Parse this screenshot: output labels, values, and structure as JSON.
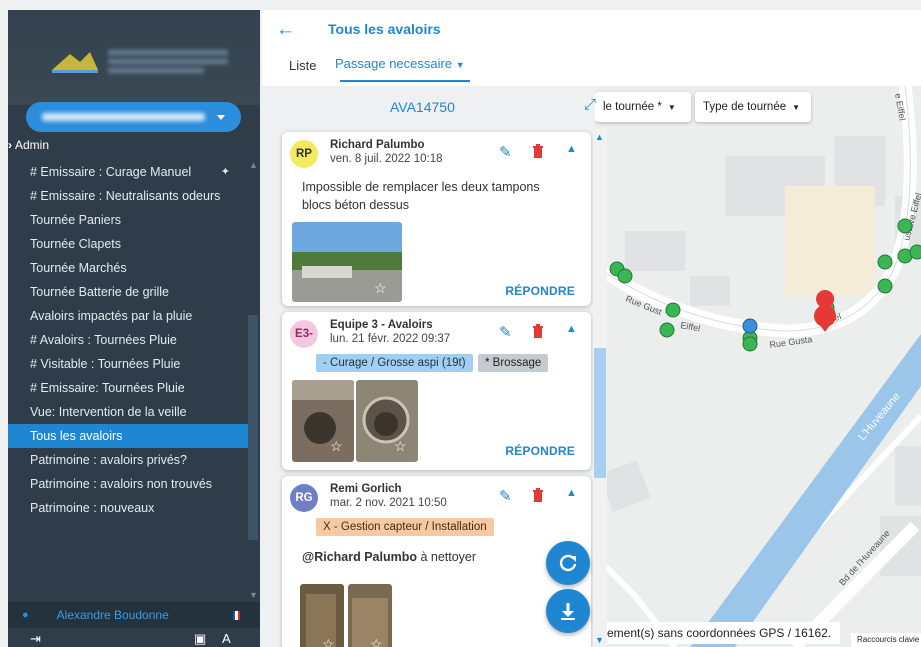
{
  "sidebar": {
    "admin_label": "Admin",
    "items": [
      {
        "label": "# Emissaire : Curage Manuel"
      },
      {
        "label": "# Emissaire : Neutralisants odeurs"
      },
      {
        "label": "Tournée Paniers"
      },
      {
        "label": "Tournée Clapets"
      },
      {
        "label": "Tournée Marchés"
      },
      {
        "label": "Tournée Batterie de grille"
      },
      {
        "label": "Avaloirs impactés par la pluie"
      },
      {
        "label": "# Avaloirs : Tournées Pluie"
      },
      {
        "label": "# Visitable : Tournées Pluie"
      },
      {
        "label": "# Emissaire: Tournées Pluie"
      },
      {
        "label": "Vue: Intervention de la veille"
      },
      {
        "label": "Tous les avaloirs"
      },
      {
        "label": "Patrimoine : avaloirs privés?"
      },
      {
        "label": "Patrimoine : avaloirs non trouvés"
      },
      {
        "label": "Patrimoine : nouveaux"
      }
    ],
    "active_index": 11,
    "user_name": "Alexandre Boudonne"
  },
  "header": {
    "title": "Tous les avaloirs",
    "tab_list": "Liste",
    "tab_passage": "Passage necessaire"
  },
  "panel": {
    "title": "AVA14750",
    "reply_label": "RÉPONDRE",
    "comments": [
      {
        "initials": "RP",
        "author": "Richard Palumbo",
        "date": "ven. 8 juil. 2022 10:18",
        "text": "Impossible de remplacer les deux tampons blocs béton dessus",
        "avatar_color": "#f5ea5f"
      },
      {
        "initials": "E3-",
        "author": "Equipe 3 - Avaloirs",
        "date": "lun. 21 févr. 2022 09:37",
        "tags": [
          "- Curage / Grosse aspi (19t)",
          "* Brossage"
        ],
        "avatar_color": "#f2c8e0"
      },
      {
        "initials": "RG",
        "author": "Remi Gorlich",
        "date": "mar. 2 nov. 2021 10:50",
        "tags": [
          "X - Gestion capteur / Installation"
        ],
        "mention": "@Richard Palumbo",
        "text_after": " à nettoyer",
        "avatar_color": "#6f7fc6"
      }
    ]
  },
  "map": {
    "filter_tournee": "le tournée *",
    "filter_type": "Type de tournée",
    "gps_text": "ement(s) sans coordonnées GPS / 16162.",
    "keyboard": "Raccourcis clavie",
    "street_labels": [
      "Rue Gust",
      "Eiffel",
      "Rue Gusta",
      "fel",
      "L'Huveaune",
      "Bd de l'Huveaune",
      "e Eiffel",
      "ustave Eiffel"
    ]
  },
  "colors": {
    "accent": "#1f86d1",
    "sidebar_bg": "#2f3d4a",
    "marker_green": "#3cb554",
    "marker_blue": "#3b8fd6",
    "marker_red": "#e53935",
    "river": "#9cc5ea"
  }
}
